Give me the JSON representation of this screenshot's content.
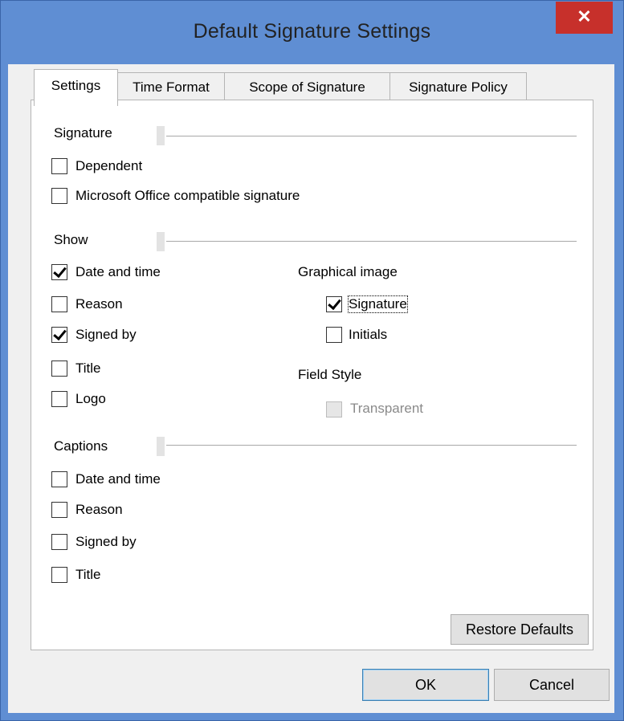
{
  "window": {
    "title": "Default Signature Settings",
    "close_glyph": "✕"
  },
  "tabs": [
    {
      "label": "Settings",
      "active": true
    },
    {
      "label": "Time Format",
      "active": false
    },
    {
      "label": "Scope of Signature",
      "active": false
    },
    {
      "label": "Signature Policy",
      "active": false
    }
  ],
  "signature": {
    "heading": "Signature",
    "dependent": {
      "label": "Dependent",
      "checked": false
    },
    "ms_office": {
      "label": "Microsoft Office compatible signature",
      "checked": false
    }
  },
  "show": {
    "heading": "Show",
    "date_time": {
      "label": "Date and time",
      "checked": true
    },
    "reason": {
      "label": "Reason",
      "checked": false
    },
    "signed_by": {
      "label": "Signed by",
      "checked": true
    },
    "title": {
      "label": "Title",
      "checked": false
    },
    "logo": {
      "label": "Logo",
      "checked": false
    }
  },
  "graphical_image": {
    "heading": "Graphical image",
    "signature": {
      "label": "Signature",
      "checked": true
    },
    "initials": {
      "label": "Initials",
      "checked": false
    }
  },
  "field_style": {
    "heading": "Field Style",
    "transparent": {
      "label": "Transparent",
      "checked": false,
      "disabled": true
    }
  },
  "captions": {
    "heading": "Captions",
    "date_time": {
      "label": "Date and time",
      "checked": false
    },
    "reason": {
      "label": "Reason",
      "checked": false
    },
    "signed_by": {
      "label": "Signed by",
      "checked": false
    },
    "title": {
      "label": "Title",
      "checked": false
    }
  },
  "buttons": {
    "restore": "Restore Defaults",
    "ok": "OK",
    "cancel": "Cancel"
  },
  "colors": {
    "titlebar": "#5f8ed3",
    "close": "#c7302b",
    "dialog_bg": "#f0f0f0"
  }
}
